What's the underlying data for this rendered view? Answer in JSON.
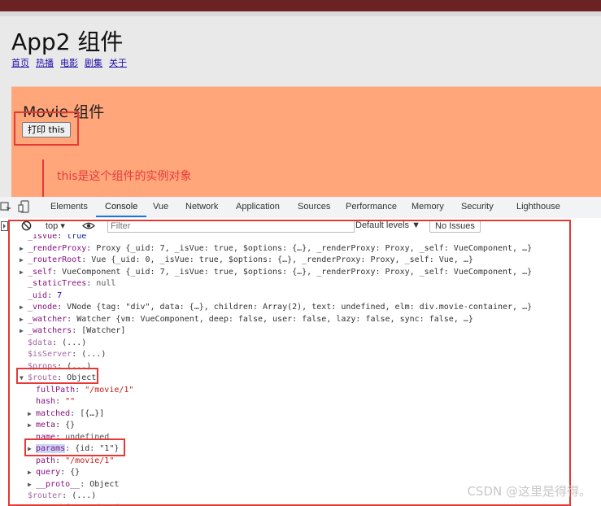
{
  "app": {
    "title": "App2 组件",
    "nav": [
      "首页",
      "热播",
      "电影",
      "剧集",
      "关于"
    ],
    "movie_title": "Movie 组件",
    "print_button": "打印 this"
  },
  "annotation": {
    "note": "this是这个组件的实例对象",
    "color": "#e53935"
  },
  "devtools": {
    "tabs": [
      "Elements",
      "Console",
      "Vue",
      "Network",
      "Application",
      "Sources",
      "Performance",
      "Memory",
      "Security",
      "Lighthouse"
    ],
    "active_tab": "Console",
    "context": "top ▾",
    "filter_placeholder": "Filter",
    "levels": "Default levels ▼",
    "issues": "No Issues"
  },
  "console": {
    "lines": [
      {
        "t": "",
        "key": "_isVue",
        "text": "true",
        "cut": true
      },
      {
        "t": "▶",
        "key": "_renderProxy",
        "text": "Proxy {_uid: 7, _isVue: true, $options: {…}, _renderProxy: Proxy, _self: VueComponent, …}"
      },
      {
        "t": "▶",
        "key": "_routerRoot",
        "text": "Vue {_uid: 0, _isVue: true, $options: {…}, _renderProxy: Proxy, _self: Vue, …}"
      },
      {
        "t": "▶",
        "key": "_self",
        "text": "VueComponent {_uid: 7, _isVue: true, $options: {…}, _renderProxy: Proxy, _self: VueComponent, …}"
      },
      {
        "t": "",
        "key": "_staticTrees",
        "text": "null"
      },
      {
        "t": "",
        "key": "_uid",
        "text": "7"
      },
      {
        "t": "▶",
        "key": "_vnode",
        "text": "VNode {tag: \"div\", data: {…}, children: Array(2), text: undefined, elm: div.movie-container, …}"
      },
      {
        "t": "▶",
        "key": "_watcher",
        "text": "Watcher {vm: VueComponent, deep: false, user: false, lazy: false, sync: false, …}"
      },
      {
        "t": "▶",
        "key": "_watchers",
        "text": "[Watcher]"
      },
      {
        "t": "",
        "key": "$data",
        "text": "(...)",
        "dim": true
      },
      {
        "t": "",
        "key": "$isServer",
        "text": "(...)",
        "dim": true
      },
      {
        "t": "",
        "key": "$props",
        "text": "(...)",
        "dim": true
      },
      {
        "t": "▼",
        "key": "$route",
        "text": "Object",
        "dim": true
      },
      {
        "t": "",
        "key": "fullPath",
        "text": "\"/movie/1\"",
        "indent": 1
      },
      {
        "t": "",
        "key": "hash",
        "text": "\"\"",
        "indent": 1
      },
      {
        "t": "▶",
        "key": "matched",
        "text": "[{…}]",
        "indent": 1
      },
      {
        "t": "▶",
        "key": "meta",
        "text": "{}",
        "indent": 1
      },
      {
        "t": "",
        "key": "name",
        "text": "undefined",
        "indent": 1
      },
      {
        "t": "▶",
        "key": "params",
        "text": "{id: \"1\"}",
        "indent": 1
      },
      {
        "t": "",
        "key": "path",
        "text": "\"/movie/1\"",
        "indent": 1
      },
      {
        "t": "▶",
        "key": "query",
        "text": "{}",
        "indent": 1
      },
      {
        "t": "▶",
        "key": "__proto__",
        "text": "Object",
        "indent": 1
      },
      {
        "t": "",
        "key": "$router",
        "text": "(...)",
        "dim": true
      },
      {
        "t": "",
        "key": "$scopedSlots",
        "text": "(...)",
        "dim": true,
        "cut": true
      }
    ]
  },
  "watermark": "CSDN @这里是得得。"
}
